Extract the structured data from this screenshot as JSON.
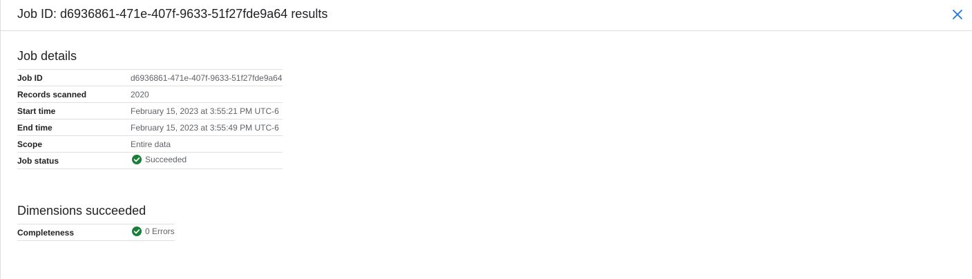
{
  "header": {
    "title": "Job ID: d6936861-471e-407f-9633-51f27fde9a64 results",
    "close_icon": "close-icon"
  },
  "job_details": {
    "title": "Job details",
    "rows": [
      {
        "key": "Job ID",
        "value": "d6936861-471e-407f-9633-51f27fde9a64"
      },
      {
        "key": "Records scanned",
        "value": "2020"
      },
      {
        "key": "Start time",
        "value": "February 15, 2023 at 3:55:21 PM UTC-6"
      },
      {
        "key": "End time",
        "value": "February 15, 2023 at 3:55:49 PM UTC-6"
      },
      {
        "key": "Scope",
        "value": "Entire data"
      },
      {
        "key": "Job status",
        "value": "Succeeded",
        "icon": "check-circle-icon"
      }
    ]
  },
  "dimensions": {
    "title": "Dimensions succeeded",
    "rows": [
      {
        "key": "Completeness",
        "value": "0 Errors",
        "icon": "check-circle-icon"
      }
    ]
  },
  "colors": {
    "success": "#188038",
    "close": "#1a73e8",
    "border": "#dadce0"
  }
}
